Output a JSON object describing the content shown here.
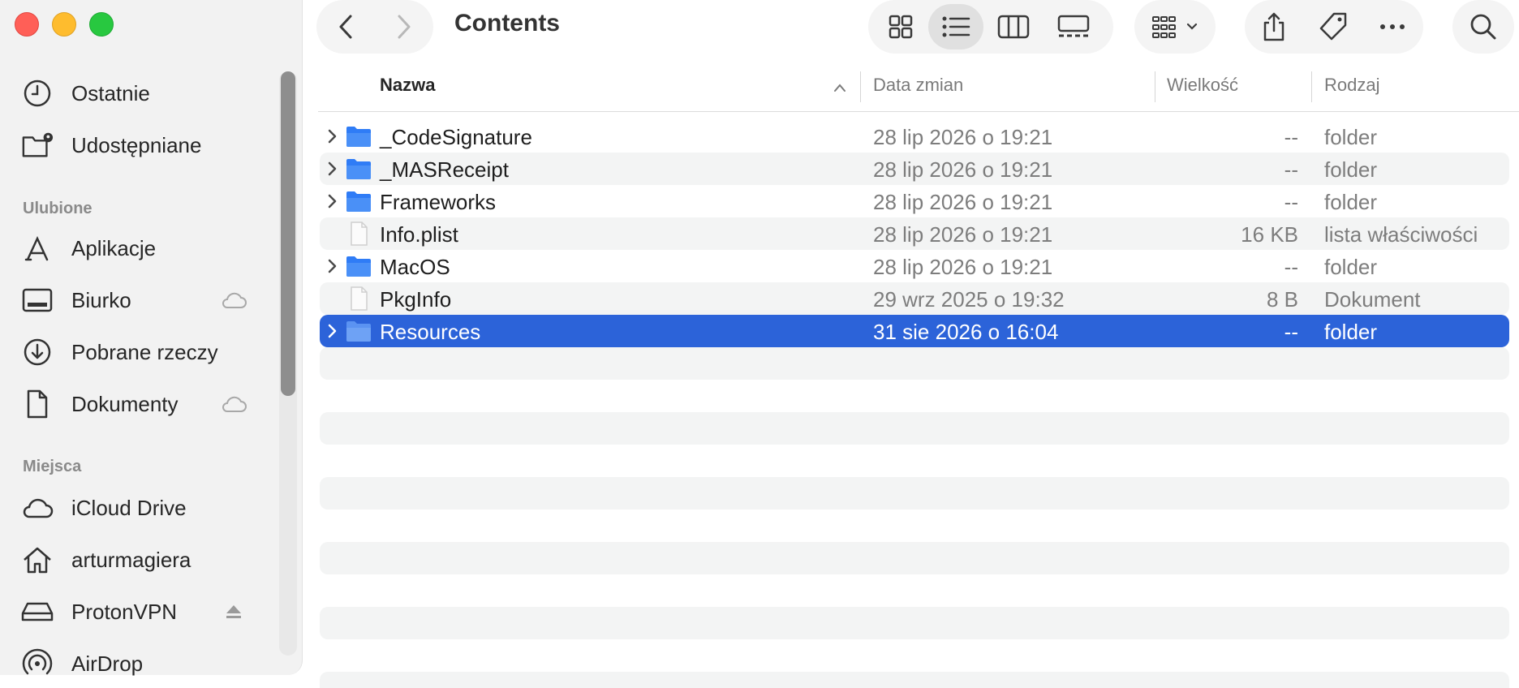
{
  "window": {
    "title": "Contents"
  },
  "sidebar": {
    "recents": [
      {
        "label": "Ostatnie",
        "icon": "clock-icon"
      },
      {
        "label": "Udostępniane",
        "icon": "shared-folder-icon"
      }
    ],
    "favorites_title": "Ulubione",
    "favorites": [
      {
        "label": "Aplikacje",
        "icon": "applications-icon"
      },
      {
        "label": "Biurko",
        "icon": "desktop-icon",
        "trail": "icloud-icon"
      },
      {
        "label": "Pobrane rzeczy",
        "icon": "download-icon"
      },
      {
        "label": "Dokumenty",
        "icon": "document-icon",
        "trail": "icloud-icon"
      }
    ],
    "locations_title": "Miejsca",
    "locations": [
      {
        "label": "iCloud Drive",
        "icon": "cloud-icon"
      },
      {
        "label": "arturmagiera",
        "icon": "home-icon"
      },
      {
        "label": "ProtonVPN",
        "icon": "drive-icon",
        "trail": "eject-icon"
      },
      {
        "label": "AirDrop",
        "icon": "airdrop-icon"
      }
    ]
  },
  "columns": {
    "name": "Nazwa",
    "date": "Data zmian",
    "size": "Wielkość",
    "kind": "Rodzaj"
  },
  "files": [
    {
      "name": "_CodeSignature",
      "date": "28 lip 2026 o 19:21",
      "size": "--",
      "kind": "folder",
      "type": "folder",
      "selected": false
    },
    {
      "name": "_MASReceipt",
      "date": "28 lip 2026 o 19:21",
      "size": "--",
      "kind": "folder",
      "type": "folder",
      "selected": false
    },
    {
      "name": "Frameworks",
      "date": "28 lip 2026 o 19:21",
      "size": "--",
      "kind": "folder",
      "type": "folder",
      "selected": false
    },
    {
      "name": "Info.plist",
      "date": "28 lip 2026 o 19:21",
      "size": "16 KB",
      "kind": "lista właściwości",
      "type": "file",
      "selected": false
    },
    {
      "name": "MacOS",
      "date": "28 lip 2026 o 19:21",
      "size": "--",
      "kind": "folder",
      "type": "folder",
      "selected": false
    },
    {
      "name": "PkgInfo",
      "date": "29 wrz 2025 o 19:32",
      "size": "8 B",
      "kind": "Dokument",
      "type": "file",
      "selected": false
    },
    {
      "name": "Resources",
      "date": "31 sie 2026 o 16:04",
      "size": "--",
      "kind": "folder",
      "type": "folder",
      "selected": true
    }
  ],
  "colors": {
    "selection": "#2c63d9",
    "folder": "#2f7cf6"
  }
}
